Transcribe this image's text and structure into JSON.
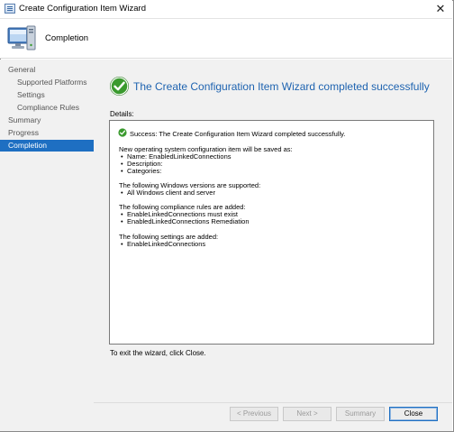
{
  "window": {
    "title": "Create Configuration Item Wizard",
    "close_glyph": "✕"
  },
  "header": {
    "title": "Completion",
    "icon": "computer-icon"
  },
  "nav": {
    "items": [
      {
        "label": "General",
        "level": 0,
        "active": false
      },
      {
        "label": "Supported Platforms",
        "level": 1,
        "active": false
      },
      {
        "label": "Settings",
        "level": 1,
        "active": false
      },
      {
        "label": "Compliance Rules",
        "level": 1,
        "active": false
      },
      {
        "label": "Summary",
        "level": 0,
        "active": false
      },
      {
        "label": "Progress",
        "level": 0,
        "active": false
      },
      {
        "label": "Completion",
        "level": 0,
        "active": true
      }
    ]
  },
  "main": {
    "success_title": "The Create Configuration Item Wizard completed successfully",
    "details_label": "Details:",
    "details": {
      "success_line": "Success: The Create Configuration Item Wizard completed successfully.",
      "saved_intro": "New operating system configuration item will be saved as:",
      "saved_items": [
        "Name: EnabledLinkedConnections",
        "Description:",
        "Categories:"
      ],
      "versions_intro": "The following Windows versions are supported:",
      "versions_items": [
        "All Windows client and server"
      ],
      "rules_intro": "The following compliance rules are added:",
      "rules_items": [
        "EnableLinkedConnections must exist",
        "EnabledLinkedConnections Remediation"
      ],
      "settings_intro": "The following settings are added:",
      "settings_items": [
        "EnableLinkedConnections"
      ]
    },
    "exit_text": "To exit the wizard, click Close."
  },
  "footer": {
    "previous_label": "< Previous",
    "next_label": "Next >",
    "summary_label": "Summary",
    "close_label": "Close"
  },
  "colors": {
    "accent": "#1e6fc2",
    "title_blue": "#1e63b0",
    "success_green": "#3a9a2e",
    "nav_bg": "#f1f1f1"
  }
}
